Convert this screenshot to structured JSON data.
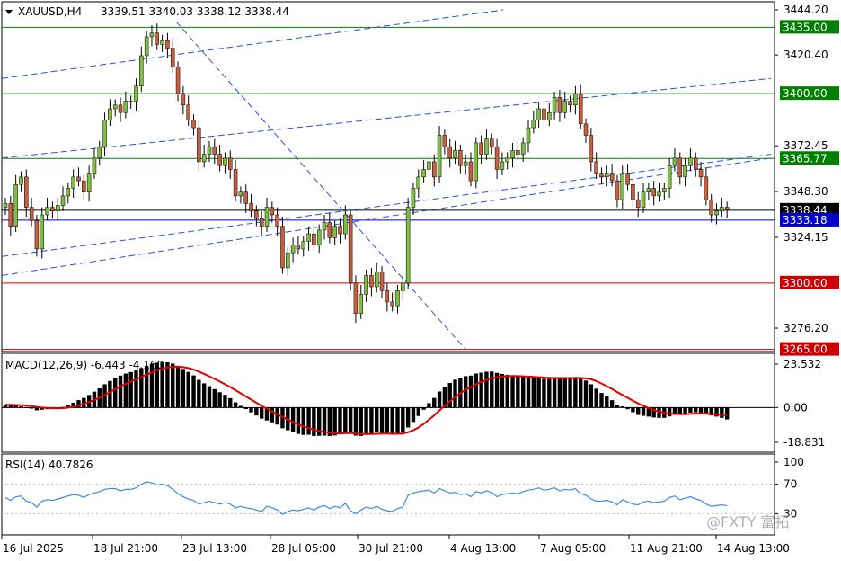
{
  "header": {
    "symbol": "XAUUSD,H4",
    "ohlc": "3339.51 3340.03 3338.12 3338.44"
  },
  "watermark": "@FXTY 富拓",
  "colors": {
    "support_line": "#cc0000",
    "resistance_line": "#008000",
    "current_line": "#0000cc",
    "channel": "#2b4fd6",
    "macd_signal": "#e00000",
    "rsi": "#3b8be0",
    "candle_up": "#7fbf3f",
    "candle_down": "#c8603f"
  },
  "chart_data": [
    {
      "type": "candlestick",
      "panel": "price",
      "symbol": "XAUUSD",
      "timeframe": "H4",
      "last_price": 3338.44,
      "price_axis_ticks": [
        3444.2,
        3420.4,
        3372.45,
        3348.3,
        3324.15,
        3276.2
      ],
      "levels": [
        {
          "value": 3435.0,
          "label": "3435.00",
          "color": "#008000"
        },
        {
          "value": 3400.0,
          "label": "3400.00",
          "color": "#008000"
        },
        {
          "value": 3365.77,
          "label": "3365.77",
          "color": "#008000"
        },
        {
          "value": 3338.44,
          "label": "3338.44",
          "color": "#000000"
        },
        {
          "value": 3333.18,
          "label": "3333.18",
          "color": "#0000cc"
        },
        {
          "value": 3300.0,
          "label": "3300.00",
          "color": "#cc0000"
        },
        {
          "value": 3265.0,
          "label": "3265.00",
          "color": "#cc0000"
        }
      ],
      "x_ticks": [
        "16 Jul 2025",
        "18 Jul 21:00",
        "23 Jul 13:00",
        "28 Jul 05:00",
        "30 Jul 21:00",
        "4 Aug 13:00",
        "7 Aug 05:00",
        "11 Aug 21:00",
        "14 Aug 13:00"
      ],
      "closes": [
        3342,
        3330,
        3352,
        3356,
        3340,
        3333,
        3318,
        3336,
        3340,
        3338,
        3341,
        3346,
        3350,
        3356,
        3354,
        3348,
        3358,
        3366,
        3372,
        3386,
        3392,
        3394,
        3390,
        3396,
        3396,
        3404,
        3420,
        3430,
        3432,
        3426,
        3428,
        3424,
        3414,
        3400,
        3394,
        3386,
        3382,
        3364,
        3368,
        3372,
        3368,
        3362,
        3366,
        3360,
        3346,
        3348,
        3342,
        3338,
        3334,
        3330,
        3340,
        3336,
        3330,
        3308,
        3316,
        3320,
        3318,
        3322,
        3326,
        3320,
        3328,
        3332,
        3324,
        3330,
        3326,
        3336,
        3300,
        3284,
        3294,
        3304,
        3298,
        3306,
        3296,
        3290,
        3288,
        3296,
        3300,
        3340,
        3350,
        3356,
        3360,
        3364,
        3356,
        3378,
        3372,
        3366,
        3370,
        3362,
        3364,
        3354,
        3374,
        3368,
        3376,
        3372,
        3360,
        3364,
        3366,
        3370,
        3368,
        3374,
        3382,
        3386,
        3392,
        3386,
        3390,
        3398,
        3390,
        3396,
        3394,
        3400,
        3384,
        3378,
        3364,
        3358,
        3356,
        3358,
        3354,
        3344,
        3358,
        3352,
        3344,
        3340,
        3348,
        3350,
        3346,
        3348,
        3350,
        3362,
        3366,
        3356,
        3362,
        3366,
        3360,
        3356,
        3344,
        3336,
        3338,
        3340,
        3338.44
      ]
    },
    {
      "type": "histogram",
      "panel": "MACD",
      "label": "MACD(12,26,9) -6.443 -4.160",
      "y_ticks": [
        23.532,
        0.0,
        -18.831
      ],
      "macd_main": [
        1.5,
        1.5,
        1.2,
        0.6,
        0.2,
        -0.6,
        -1.5,
        -1.2,
        -0.9,
        -0.8,
        -0.5,
        0.3,
        1.3,
        2.6,
        4.0,
        5.2,
        6.8,
        8.6,
        10.4,
        12.6,
        14.4,
        16.2,
        17.3,
        18.4,
        19.2,
        20.1,
        21.4,
        22.6,
        23.7,
        24.3,
        24.6,
        24.5,
        23.8,
        22.5,
        20.9,
        19.3,
        17.4,
        15.0,
        13.1,
        11.6,
        10.0,
        8.3,
        6.9,
        5.1,
        2.8,
        0.9,
        -0.8,
        -2.6,
        -4.3,
        -6.0,
        -7.0,
        -8.0,
        -9.2,
        -11.2,
        -12.3,
        -13.4,
        -14.3,
        -14.8,
        -14.7,
        -15.4,
        -15.3,
        -15.2,
        -15.4,
        -15.1,
        -14.5,
        -13.2,
        -13.7,
        -15.2,
        -15.4,
        -14.5,
        -14.1,
        -13.5,
        -13.9,
        -14.3,
        -14.6,
        -14.2,
        -13.6,
        -10.8,
        -7.8,
        -4.6,
        -1.2,
        2.4,
        5.2,
        8.7,
        11.3,
        13.3,
        15.1,
        16.1,
        17.0,
        17.3,
        18.4,
        18.9,
        19.4,
        19.5,
        18.8,
        18.2,
        17.7,
        17.3,
        16.8,
        16.5,
        16.3,
        16.0,
        15.9,
        15.6,
        15.6,
        15.8,
        15.8,
        16.0,
        16.0,
        16.2,
        15.6,
        14.6,
        12.6,
        10.2,
        7.9,
        6.1,
        4.0,
        1.5,
        0.6,
        -0.9,
        -2.5,
        -4.0,
        -4.5,
        -4.9,
        -5.4,
        -5.6,
        -5.6,
        -4.8,
        -3.8,
        -3.6,
        -3.2,
        -2.7,
        -2.6,
        -2.8,
        -3.5,
        -4.3,
        -4.9,
        -5.6,
        -6.443
      ],
      "signal": [
        1.5,
        1.5,
        1.4,
        1.3,
        1.1,
        0.8,
        0.3,
        0.0,
        -0.2,
        -0.4,
        -0.4,
        -0.3,
        0.0,
        0.5,
        1.2,
        2.0,
        3.0,
        4.1,
        5.4,
        6.8,
        8.3,
        9.9,
        11.4,
        12.8,
        14.1,
        15.3,
        16.6,
        17.8,
        19.0,
        20.1,
        21.0,
        21.7,
        22.1,
        22.2,
        21.9,
        21.4,
        20.6,
        19.5,
        18.2,
        16.9,
        15.5,
        14.1,
        12.6,
        11.1,
        9.4,
        7.7,
        6.0,
        4.3,
        2.6,
        0.9,
        -0.7,
        -2.2,
        -3.6,
        -5.1,
        -6.5,
        -7.9,
        -9.2,
        -10.3,
        -11.2,
        -12.0,
        -12.7,
        -13.2,
        -13.6,
        -13.9,
        -14.0,
        -13.9,
        -13.8,
        -14.1,
        -14.3,
        -14.4,
        -14.3,
        -14.2,
        -14.1,
        -14.1,
        -14.2,
        -14.2,
        -14.1,
        -13.4,
        -12.3,
        -10.8,
        -8.9,
        -6.6,
        -4.2,
        -1.6,
        1.0,
        3.4,
        5.7,
        7.8,
        9.6,
        11.1,
        12.6,
        13.8,
        14.9,
        15.8,
        16.4,
        16.8,
        17.0,
        17.1,
        17.0,
        16.9,
        16.8,
        16.6,
        16.4,
        16.2,
        16.1,
        16.0,
        16.0,
        16.0,
        16.0,
        16.1,
        16.0,
        15.8,
        15.3,
        14.3,
        13.0,
        11.6,
        10.1,
        8.4,
        6.8,
        5.3,
        3.7,
        2.2,
        0.9,
        -0.3,
        -1.3,
        -2.2,
        -2.9,
        -3.3,
        -3.5,
        -3.6,
        -3.6,
        -3.4,
        -3.3,
        -3.2,
        -3.3,
        -3.5,
        -3.8,
        -4.0,
        -4.16
      ]
    },
    {
      "type": "line",
      "panel": "RSI",
      "label": "RSI(14) 40.7826",
      "y_ticks": [
        100,
        70,
        30
      ],
      "levels": [
        70,
        30
      ],
      "values": [
        52,
        48,
        53,
        54,
        47,
        45,
        39,
        47,
        49,
        48,
        50,
        52,
        54,
        56,
        55,
        52,
        56,
        58,
        60,
        63,
        64,
        64,
        61,
        63,
        63,
        65,
        70,
        73,
        72,
        69,
        70,
        68,
        63,
        57,
        53,
        50,
        48,
        43,
        45,
        47,
        45,
        43,
        45,
        43,
        38,
        40,
        38,
        37,
        35,
        33,
        40,
        38,
        35,
        29,
        33,
        35,
        34,
        36,
        38,
        35,
        39,
        41,
        37,
        40,
        38,
        44,
        34,
        30,
        35,
        39,
        37,
        40,
        36,
        34,
        33,
        37,
        39,
        55,
        58,
        60,
        61,
        62,
        58,
        64,
        61,
        58,
        59,
        56,
        57,
        53,
        60,
        58,
        61,
        59,
        53,
        56,
        57,
        58,
        57,
        60,
        62,
        63,
        65,
        62,
        63,
        65,
        61,
        63,
        62,
        64,
        57,
        55,
        50,
        47,
        47,
        48,
        46,
        42,
        49,
        46,
        43,
        42,
        46,
        47,
        45,
        46,
        47,
        52,
        54,
        49,
        51,
        53,
        50,
        48,
        43,
        40,
        41,
        42,
        40.7826
      ]
    }
  ]
}
